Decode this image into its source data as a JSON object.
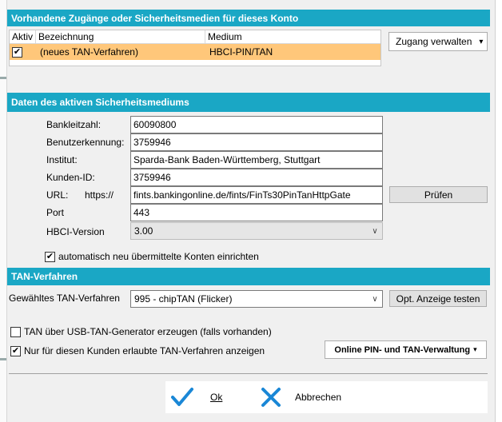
{
  "accounts_section": {
    "title": "Vorhandene Zugänge oder Sicherheitsmedien für dieses Konto",
    "columns": [
      "Aktiv",
      "Bezeichnung",
      "Medium"
    ],
    "rows": [
      {
        "active": true,
        "name": "(neues TAN-Verfahren)",
        "medium": "HBCI-PIN/TAN"
      }
    ],
    "manage_button": "Zugang verwalten",
    "manage_button_arrow": "▾"
  },
  "medium_section": {
    "title": "Daten des aktiven Sicherheitsmediums",
    "bank_code_label": "Bankleitzahl:",
    "bank_code": "60090800",
    "user_id_label": "Benutzerkennung:",
    "user_id": "3759946",
    "institute_label": "Institut:",
    "institute": "Sparda-Bank Baden-Württemberg, Stuttgart",
    "customer_id_label": "Kunden-ID:",
    "customer_id": "3759946",
    "url_label": "URL:",
    "url_prefix": "https://",
    "url": "fints.bankingonline.de/fints/FinTs30PinTanHttpGate",
    "check_button": "Prüfen",
    "port_label": "Port",
    "port": "443",
    "hbci_version_label": "HBCI-Version",
    "hbci_version": "3.00",
    "auto_setup_label": "automatisch neu übermittelte Konten einrichten",
    "auto_setup_checked": true
  },
  "tan_section": {
    "title": "TAN-Verfahren",
    "selected_label": "Gewähltes TAN-Verfahren",
    "selected_value": "995 - chipTAN (Flicker)",
    "test_button": "Opt. Anzeige testen",
    "usb_generator_label": "TAN über USB-TAN-Generator erzeugen (falls vorhanden)",
    "usb_generator_checked": false,
    "only_allowed_label": "Nur für diesen Kunden erlaubte TAN-Verfahren anzeigen",
    "only_allowed_checked": true,
    "online_admin_button": "Online PIN- und TAN-Verwaltung",
    "online_admin_arrow": "▾"
  },
  "footer": {
    "ok_label": "Ok",
    "cancel_label": "Abbrechen"
  },
  "colors": {
    "section_header": "#1aa7c5",
    "selected_row": "#ffc77a",
    "ok_icon": "#1a87d6",
    "cancel_icon": "#1a87d6"
  }
}
